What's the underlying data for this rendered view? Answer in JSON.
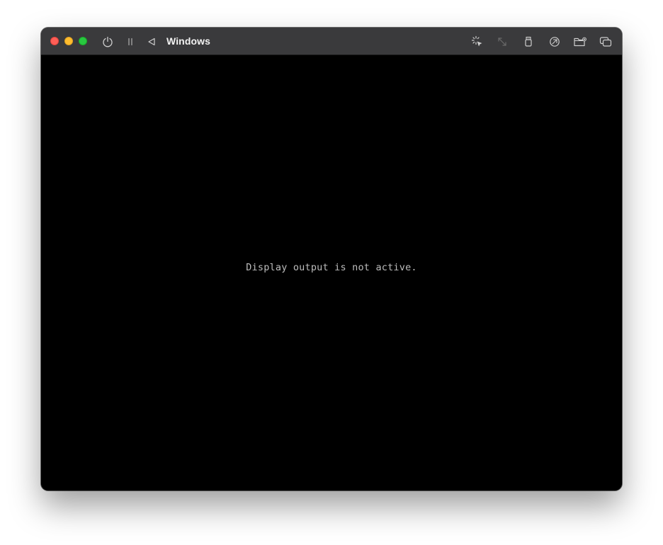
{
  "window": {
    "title": "Windows"
  },
  "toolbar": {
    "left_icons": [
      "power-icon",
      "pause-icon",
      "back-icon"
    ],
    "right_icons": [
      "capture-input-icon",
      "resize-icon",
      "usb-icon",
      "network-icon",
      "shared-folder-icon",
      "windows-icon"
    ]
  },
  "screen": {
    "message": "Display output is not active."
  },
  "colors": {
    "titlebar": "#3a3a3c",
    "screen": "#000000",
    "close": "#ff5f57",
    "minimize": "#febc2e",
    "zoom": "#28c840",
    "message_text": "#bdbdbd"
  }
}
